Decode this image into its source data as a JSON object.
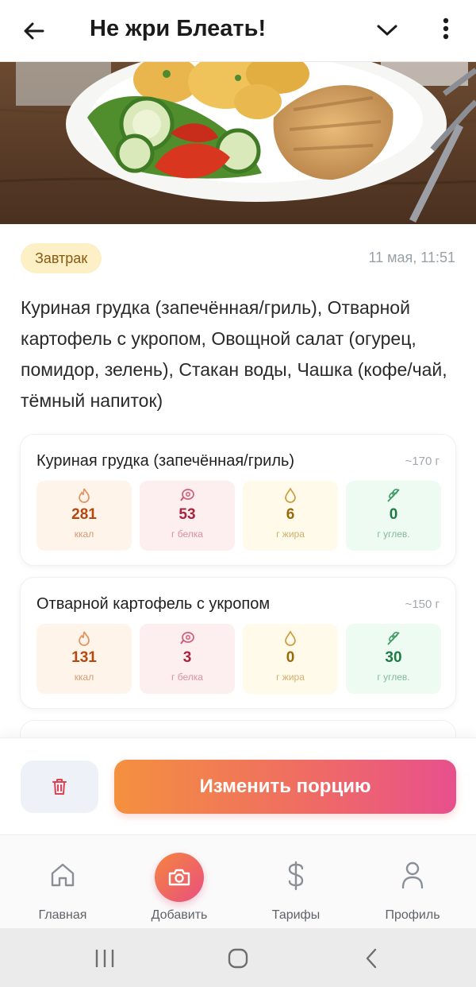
{
  "header": {
    "title": "Не жри Блеать!"
  },
  "meal": {
    "type": "Завтрак",
    "time": "11 мая, 11:51",
    "description": "Куриная грудка (запечённая/гриль), Отварной картофель с укропом, Овощной салат (огурец, помидор, зелень), Стакан воды, Чашка (кофе/чай, тёмный напиток)"
  },
  "items": [
    {
      "name": "Куриная грудка (запечённая/гриль)",
      "weight": "~170 г",
      "kcal": "281",
      "kcal_unit": "ккал",
      "protein": "53",
      "protein_unit": "г белка",
      "fat": "6",
      "fat_unit": "г жира",
      "carbs": "0",
      "carbs_unit": "г углев."
    },
    {
      "name": "Отварной картофель с укропом",
      "weight": "~150 г",
      "kcal": "131",
      "kcal_unit": "ккал",
      "protein": "3",
      "protein_unit": "г белка",
      "fat": "0",
      "fat_unit": "г жира",
      "carbs": "30",
      "carbs_unit": "г углев."
    }
  ],
  "actions": {
    "edit_label": "Изменить порцию"
  },
  "nav": {
    "home": "Главная",
    "add": "Добавить",
    "plans": "Тарифы",
    "profile": "Профиль"
  },
  "colors": {
    "accent_start": "#f4903f",
    "accent_end": "#e8508d",
    "badge_bg": "#fdf0c7"
  }
}
